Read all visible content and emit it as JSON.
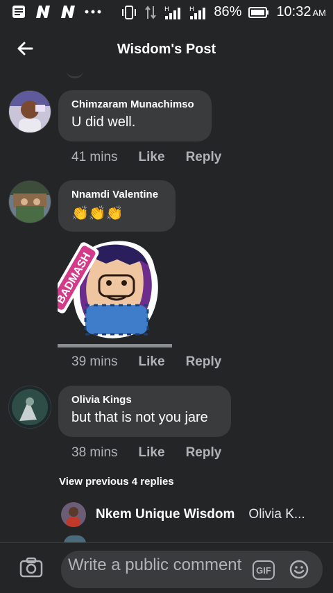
{
  "status_bar": {
    "left_icons": [
      "notification-icon",
      "n-app-icon",
      "n-app-icon",
      "more-dots-icon"
    ],
    "battery_percent": "86%",
    "time": "10:32",
    "ampm": "AM"
  },
  "header": {
    "title": "Wisdom's Post"
  },
  "comments": [
    {
      "name": "Chimzaram Munachimso",
      "text": "U did well.",
      "time": "41 mins",
      "like": "Like",
      "reply": "Reply"
    },
    {
      "name": "Nnamdi Valentine",
      "text": "👏👏👏",
      "time": "39 mins",
      "like": "Like",
      "reply": "Reply",
      "sticker_text": "BADMASH"
    },
    {
      "name": "Olivia Kings",
      "text": "but that is not you jare",
      "time": "38 mins",
      "like": "Like",
      "reply": "Reply"
    }
  ],
  "view_previous": "View previous 4 replies",
  "reply_preview": {
    "name": "Nkem Unique Wisdom",
    "snippet": "Olivia K..."
  },
  "composer": {
    "placeholder": "Write a public comment",
    "gif_label": "GIF"
  },
  "colors": {
    "background": "#242526",
    "bubble": "#3a3b3c",
    "muted_text": "#b0b3b8",
    "text": "#ffffff"
  }
}
